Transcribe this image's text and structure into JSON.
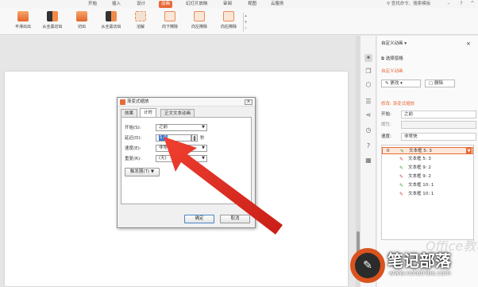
{
  "menubar": {
    "tabs": [
      "开始",
      "插入",
      "设计",
      "动画",
      "幻灯片放映",
      "审阅",
      "视图",
      "云服务"
    ],
    "active_tab": "动画",
    "search": "查找命令、搜索模板"
  },
  "ribbon": {
    "effects": [
      "平滑出出",
      "从全黑切出",
      "切出",
      "从全黑切出",
      "溶解",
      "向下擦除",
      "向左擦除",
      "向右擦除"
    ]
  },
  "dialog": {
    "title": "渐变式缩放",
    "tabs": [
      "效果",
      "计时",
      "正文文本动画"
    ],
    "active_tab": "计时",
    "start_label": "开始(S):",
    "start_value": "之前",
    "delay_label": "延迟(D):",
    "delay_value": "1.0",
    "delay_unit": "秒",
    "speed_label": "速度(E):",
    "speed_value": "非常快(0.5 秒)",
    "repeat_label": "重复(R):",
    "repeat_value": "(无)",
    "trigger_label": "触发器(T) ▼",
    "ok_label": "确定",
    "cancel_label": "取消"
  },
  "panel": {
    "title": "自定义动画 ▾",
    "select_pane": "选择窗格",
    "section_title": "自定义动画",
    "change_label": "更改 ▾",
    "delete_label": "删除",
    "modify_title": "修改: 渐变式缩放",
    "start_label": "开始:",
    "start_value": "之前",
    "property_label": "属性:",
    "speed_label": "速度:",
    "speed_value": "非常快",
    "items": [
      {
        "num": "0",
        "mark": "✎",
        "text": "文本框 5: 3",
        "color": "#3a9c3a"
      },
      {
        "num": "",
        "mark": "✎",
        "text": "文本框 5: 3",
        "color": "#d23a3a"
      },
      {
        "num": "",
        "mark": "✎",
        "text": "文本框 9: 2",
        "color": "#3a9c3a"
      },
      {
        "num": "",
        "mark": "✎",
        "text": "文本框 9: 2",
        "color": "#d23a3a"
      },
      {
        "num": "",
        "mark": "✎",
        "text": "文本框 10: 1",
        "color": "#3a9c3a"
      },
      {
        "num": "",
        "mark": "✎",
        "text": "文本框 10: 1",
        "color": "#d23a3a"
      }
    ]
  },
  "watermark": {
    "title": "笔记部落",
    "url": "www.notetribe.com",
    "ghost": "Office教程网"
  },
  "colors": {
    "accent": "#e86a37",
    "arrow": "#e0201f"
  }
}
